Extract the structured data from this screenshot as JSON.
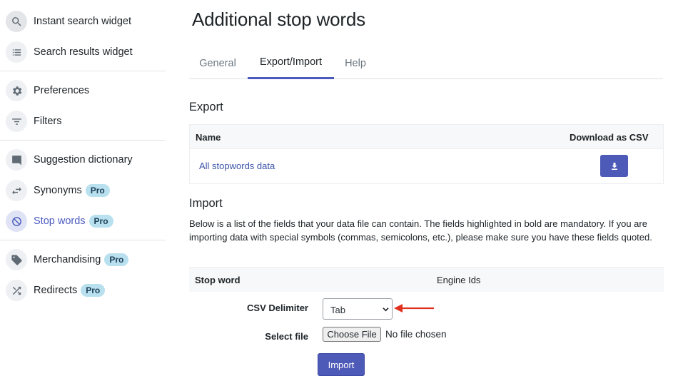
{
  "sidebar": {
    "items": [
      {
        "label": "Instant search widget",
        "icon": "search-icon",
        "pro": ""
      },
      {
        "label": "Search results widget",
        "icon": "list-icon",
        "pro": ""
      },
      {
        "label": "Preferences",
        "icon": "gear-icon",
        "pro": ""
      },
      {
        "label": "Filters",
        "icon": "filter-icon",
        "pro": ""
      },
      {
        "label": "Suggestion dictionary",
        "icon": "comment-icon",
        "pro": ""
      },
      {
        "label": "Synonyms",
        "icon": "swap-icon",
        "pro": "Pro"
      },
      {
        "label": "Stop words",
        "icon": "block-icon",
        "pro": "Pro",
        "active": true
      },
      {
        "label": "Merchandising",
        "icon": "tag-icon",
        "pro": "Pro"
      },
      {
        "label": "Redirects",
        "icon": "shuffle-icon",
        "pro": "Pro"
      }
    ]
  },
  "page": {
    "title": "Additional stop words"
  },
  "tabs": [
    {
      "label": "General"
    },
    {
      "label": "Export/Import",
      "active": true
    },
    {
      "label": "Help"
    }
  ],
  "export": {
    "title": "Export",
    "col_name": "Name",
    "col_download": "Download as CSV",
    "row_label": "All stopwords data",
    "download_icon": "download-icon"
  },
  "import": {
    "title": "Import",
    "description": "Below is a list of the fields that your data file can contain. The fields highlighted in bold are mandatory. If you are importing data with special symbols (commas, semicolons, etc.), please make sure you have these fields quoted.",
    "fields": [
      {
        "label": "Stop word",
        "mandatory": true
      },
      {
        "label": "Engine Ids",
        "mandatory": false
      }
    ],
    "delimiter_label": "CSV Delimiter",
    "delimiter_value": "Tab",
    "file_label": "Select file",
    "file_button": "Choose File",
    "file_status": "No file chosen",
    "import_button": "Import"
  },
  "colors": {
    "accent": "#4e5ab8",
    "link": "#3b54a8",
    "pro_badge": "#b8e0ef",
    "annotation_arrow": "#e0301e"
  }
}
